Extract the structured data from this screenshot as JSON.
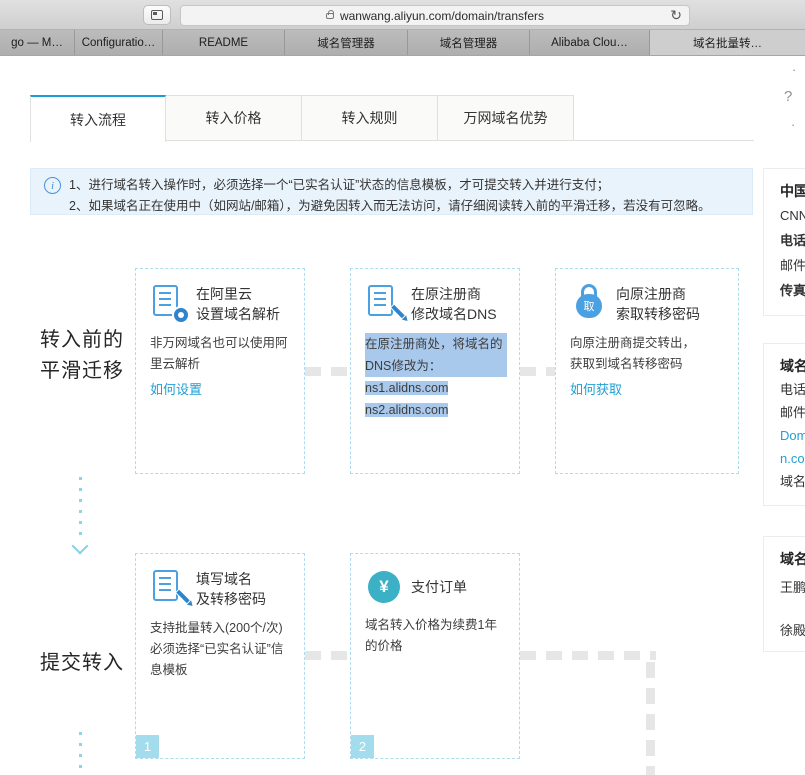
{
  "browser": {
    "url": "wanwang.aliyun.com/domain/transfers",
    "refresh_icon": "↻",
    "tabs": [
      {
        "label": "go — M…"
      },
      {
        "label": "Configuratio…"
      },
      {
        "label": "README"
      },
      {
        "label": "域名管理器"
      },
      {
        "label": "域名管理器"
      },
      {
        "label": "Alibaba Clou…"
      },
      {
        "label": "域名批量转…"
      }
    ]
  },
  "page": {
    "nav_tabs": [
      {
        "label": "转入流程"
      },
      {
        "label": "转入价格"
      },
      {
        "label": "转入规则"
      },
      {
        "label": "万网域名优势"
      }
    ],
    "notice": {
      "icon": "i",
      "line1": "1、进行域名转入操作时，必须选择一个“已实名认证”状态的信息模板，才可提交转入并进行支付；",
      "line2": "2、如果域名正在使用中（如网站/邮箱），为避免因转入而无法访问，请仔细阅读转入前的平滑迁移，若没有可忽略。"
    },
    "section1": {
      "label1": "转入前的",
      "label2": "平滑迁移",
      "card1": {
        "title1": "在阿里云",
        "title2": "设置域名解析",
        "body": "非万网域名也可以使用阿里云解析",
        "link": "如何设置"
      },
      "card2": {
        "title1": "在原注册商",
        "title2": "修改域名DNS",
        "sel_line1": "在原注册商处，将域名的",
        "sel_line2": "DNS修改为：",
        "sel_line3": "ns1.alidns.com",
        "sel_line4": "ns2.alidns.com"
      },
      "card3": {
        "icon_text": "取",
        "title1": "向原注册商",
        "title2": "索取转移密码",
        "body1": "向原注册商提交转出，",
        "body2": "获取到域名转移密码",
        "link": "如何获取"
      }
    },
    "section2": {
      "label": "提交转入",
      "card1": {
        "num": "1",
        "title1": "填写域名",
        "title2": "及转移密码",
        "body1": "支持批量转入(200个/次)",
        "body2": "必须选择“已实名认证”信息模板"
      },
      "card2": {
        "num": "2",
        "icon_text": "¥",
        "title": "支付订单",
        "body1": "域名转入价格为续费1年",
        "body2": "的价格"
      }
    },
    "help": {
      "q": "?",
      "dot1": "·",
      "dot2": "·"
    },
    "sidebar": {
      "box1": {
        "header": "中国",
        "i1": "CNN",
        "i2": "电话",
        "i3": "邮件",
        "i4": "传真"
      },
      "box2": {
        "header": "域名",
        "i1": "电话",
        "i2": "邮件",
        "l1": "Dom",
        "l2": "n.co",
        "i3": "域名"
      },
      "box3": {
        "header": "域名",
        "i1": "王鹏",
        "i2": "徐殿"
      }
    }
  }
}
